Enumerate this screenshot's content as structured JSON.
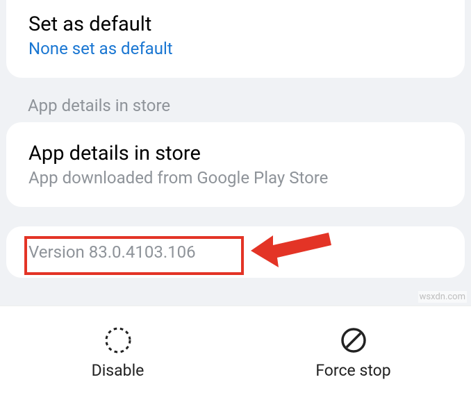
{
  "set_default": {
    "title": "Set as default",
    "subtitle": "None set as default"
  },
  "section_header": "App details in store",
  "app_details": {
    "title": "App details in store",
    "subtitle": "App downloaded from Google Play Store"
  },
  "version": {
    "label": "Version 83.0.4103.106"
  },
  "buttons": {
    "disable": "Disable",
    "force_stop": "Force stop"
  },
  "watermark": "wsxdn.com"
}
